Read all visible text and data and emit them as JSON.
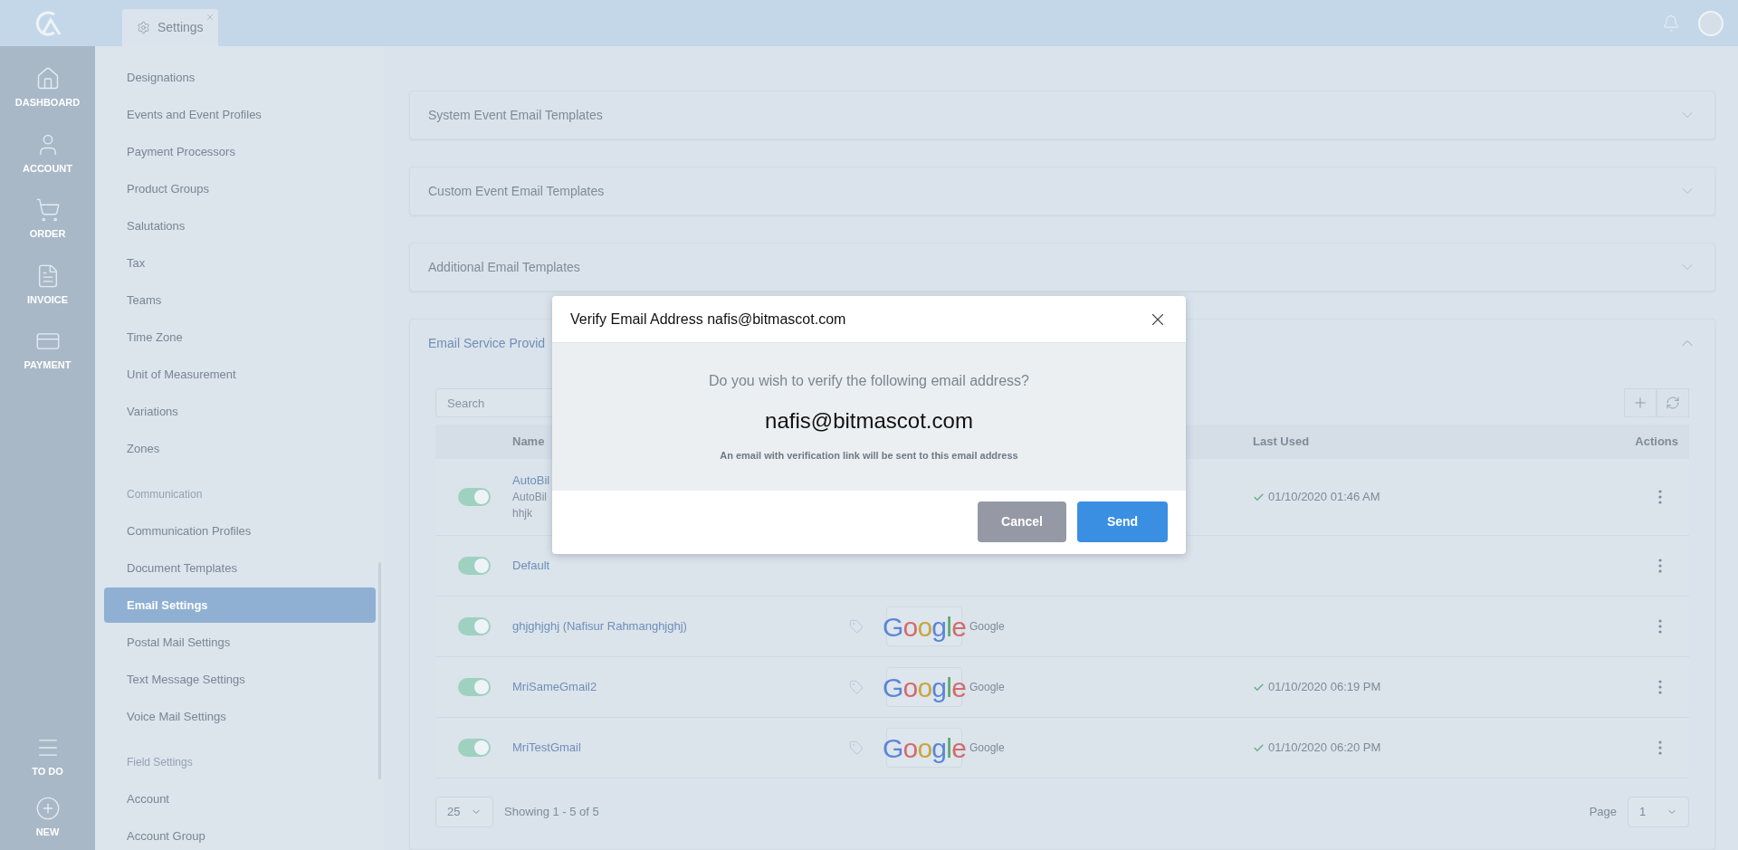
{
  "top_bar": {
    "tab": {
      "label": "Settings",
      "selected": true
    }
  },
  "nav": [
    {
      "label": "DASHBOARD"
    },
    {
      "label": "ACCOUNT"
    },
    {
      "label": "ORDER"
    },
    {
      "label": "INVOICE"
    },
    {
      "label": "PAYMENT"
    }
  ],
  "nav_bottom": [
    {
      "label": "TO DO"
    },
    {
      "label": "NEW"
    }
  ],
  "sidebar": {
    "sections": [
      {
        "items": [
          {
            "label": "Designations",
            "selected": false
          },
          {
            "label": "Events and Event Profiles",
            "selected": false
          },
          {
            "label": "Payment Processors",
            "selected": false
          },
          {
            "label": "Product Groups",
            "selected": false
          },
          {
            "label": "Salutations",
            "selected": false
          },
          {
            "label": "Tax",
            "selected": false
          },
          {
            "label": "Teams",
            "selected": false
          },
          {
            "label": "Time Zone",
            "selected": false
          },
          {
            "label": "Unit of Measurement",
            "selected": false
          },
          {
            "label": "Variations",
            "selected": false
          },
          {
            "label": "Zones",
            "selected": false
          }
        ]
      },
      {
        "heading": "Communication",
        "items": [
          {
            "label": "Communication Profiles",
            "selected": false
          },
          {
            "label": "Document Templates",
            "selected": false
          },
          {
            "label": "Email Settings",
            "selected": true
          },
          {
            "label": "Postal Mail Settings",
            "selected": false
          },
          {
            "label": "Text Message Settings",
            "selected": false
          },
          {
            "label": "Voice Mail Settings",
            "selected": false
          }
        ]
      },
      {
        "heading": "Field Settings",
        "items": [
          {
            "label": "Account",
            "selected": false
          },
          {
            "label": "Account Group",
            "selected": false
          }
        ]
      }
    ]
  },
  "accordions": [
    {
      "title": "System Event Email Templates",
      "expanded": false
    },
    {
      "title": "Custom Event Email Templates",
      "expanded": false
    },
    {
      "title": "Additional Email Templates",
      "expanded": false
    },
    {
      "title": "Email Service Provid",
      "expanded": true,
      "table": {
        "search": {
          "placeholder": "Search"
        },
        "columns": {
          "name": "Name",
          "last_used": "Last Used",
          "actions": "Actions"
        },
        "rows": [
          {
            "enabled": true,
            "name": "AutoBil",
            "details": [
              "AutoBil",
              "hhjk"
            ],
            "last_used": "01/10/2020 01:46 AM"
          },
          {
            "enabled": true,
            "name": "Default"
          },
          {
            "enabled": true,
            "name": "ghjghjghj (Nafisur Rahmanghjghj)",
            "logo": "Google",
            "provider": "Google"
          },
          {
            "enabled": true,
            "name": "MriSameGmail2",
            "logo": "Google",
            "provider": "Google",
            "last_used": "01/10/2020 06:19 PM"
          },
          {
            "enabled": true,
            "name": "MriTestGmail",
            "logo": "Google",
            "provider": "Google",
            "last_used": "01/10/2020 06:20 PM"
          }
        ],
        "pagination": {
          "page_size": "25",
          "showing": "Showing 1 - 5 of 5",
          "page_label": "Page",
          "page": "1"
        }
      }
    }
  ],
  "dialog": {
    "title": "Verify Email Address nafis@bitmascot.com",
    "question": "Do you wish to verify the following email address?",
    "email": "nafis@bitmascot.com",
    "note": "An email with verification link will be sent to this email address",
    "buttons": [
      {
        "label": "Cancel",
        "kind": "secondary"
      },
      {
        "label": "Send",
        "kind": "primary"
      }
    ]
  }
}
